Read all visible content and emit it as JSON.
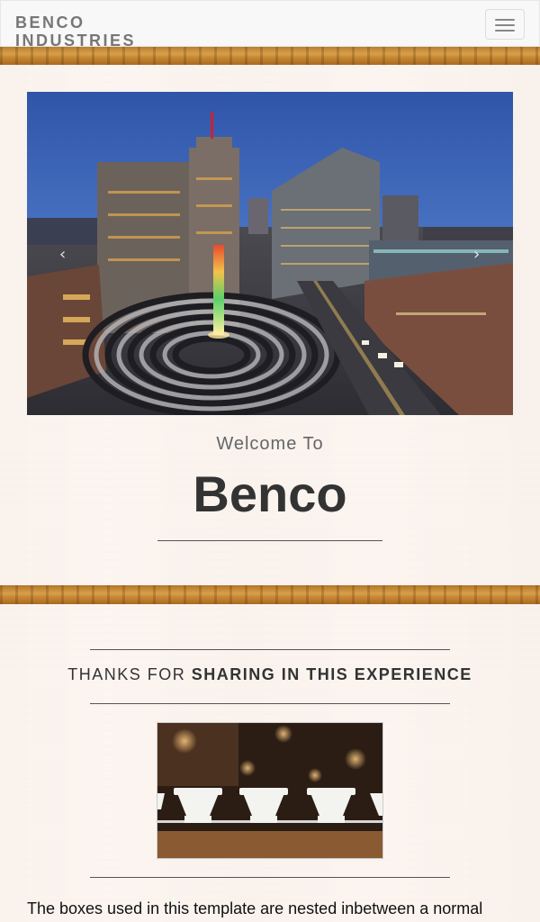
{
  "navbar": {
    "brand": "BENCO INDUSTRIES",
    "toggle_icon": "hamburger-icon"
  },
  "carousel": {
    "image_description_icon": "city-plaza-photo",
    "prev_icon": "chevron-left-icon",
    "next_icon": "chevron-right-icon",
    "prev_glyph": "‹",
    "next_glyph": "›"
  },
  "intro": {
    "welcome_small": "Welcome To",
    "welcome_big": "Benco"
  },
  "section": {
    "title_light": "THANKS FOR ",
    "title_bold": "SHARING IN THIS EXPERIENCE",
    "image_icon": "coffee-drippers-photo",
    "body_text": "The boxes used in this template are nested inbetween a normal"
  },
  "colors": {
    "wood": "#c98a35",
    "navbar_bg": "#f8f8f8",
    "brand_text": "#777777",
    "heading_text": "#333333"
  }
}
